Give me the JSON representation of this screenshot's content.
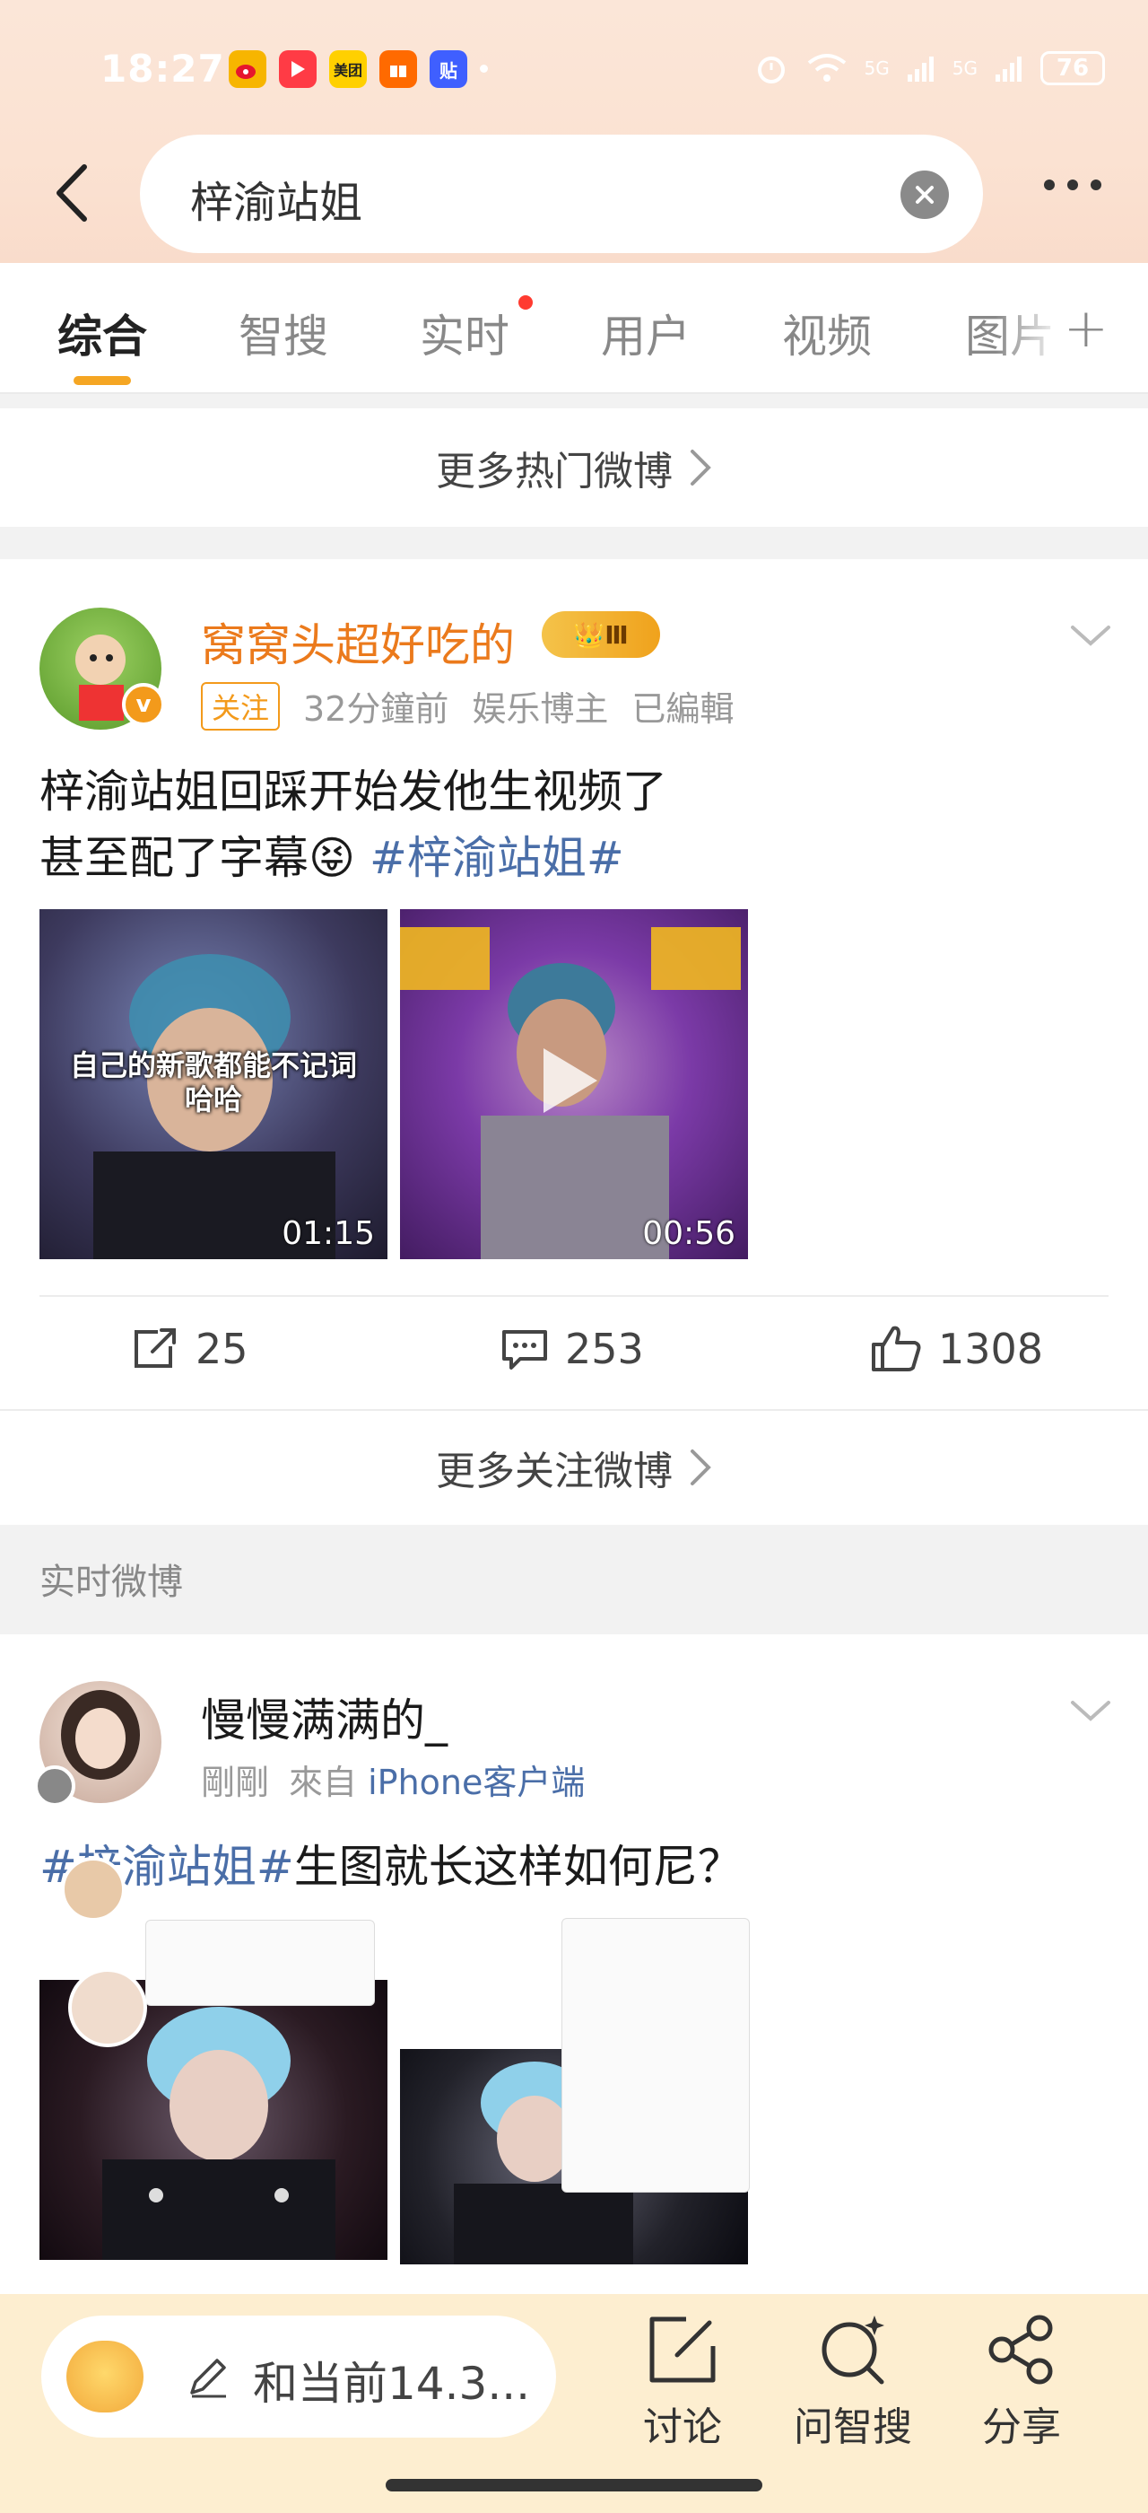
{
  "status_bar": {
    "time": "18:27",
    "app_icons": [
      "weibo-icon",
      "video-icon",
      "meituan-icon",
      "gift-icon",
      "tieba-icon"
    ],
    "app_badge_labels": [
      "",
      "",
      "美团",
      "",
      "贴"
    ],
    "network": [
      "5G",
      "5G"
    ],
    "battery": "76"
  },
  "search": {
    "query": "梓渝站姐"
  },
  "tabs": [
    {
      "label": "综合",
      "active": true
    },
    {
      "label": "智搜",
      "active": false
    },
    {
      "label": "实时",
      "active": false,
      "has_dot": true
    },
    {
      "label": "用户",
      "active": false
    },
    {
      "label": "视频",
      "active": false
    },
    {
      "label": "图片",
      "active": false
    }
  ],
  "more_hot": "更多热门微博",
  "post1": {
    "username": "窝窝头超好吃的",
    "level": "Ⅲ",
    "follow": "关注",
    "time": "32分鐘前",
    "category": "娱乐博主",
    "edited": "已編輯",
    "text_line1": "梓渝站姐回踩开始发他生视频了",
    "text_line2": "甚至配了字幕",
    "emoji": "😝",
    "hashtag": "#梓渝站姐#",
    "video1_caption": "自己的新歌都能不记词\n哈哈",
    "video1_duration": "01:15",
    "video2_duration": "00:56",
    "reposts": "25",
    "comments": "253",
    "likes": "1308"
  },
  "more_follow": "更多关注微博",
  "section_label": "实时微博",
  "post2": {
    "username": "慢慢满满的_",
    "time": "剛剛",
    "from": "來自",
    "source": "iPhone客户端",
    "hashtag": "#梓渝站姐#",
    "text": "生图就长这样如何尼？"
  },
  "bottom": {
    "input_placeholder": "和当前14.3...",
    "discuss": "讨论",
    "ask": "问智搜",
    "share": "分享"
  },
  "colors": {
    "accent": "#f5a623",
    "username_orange": "#eb7a1c",
    "link_blue": "#4a6ea8",
    "bottom_bg": "#fdeed0"
  }
}
